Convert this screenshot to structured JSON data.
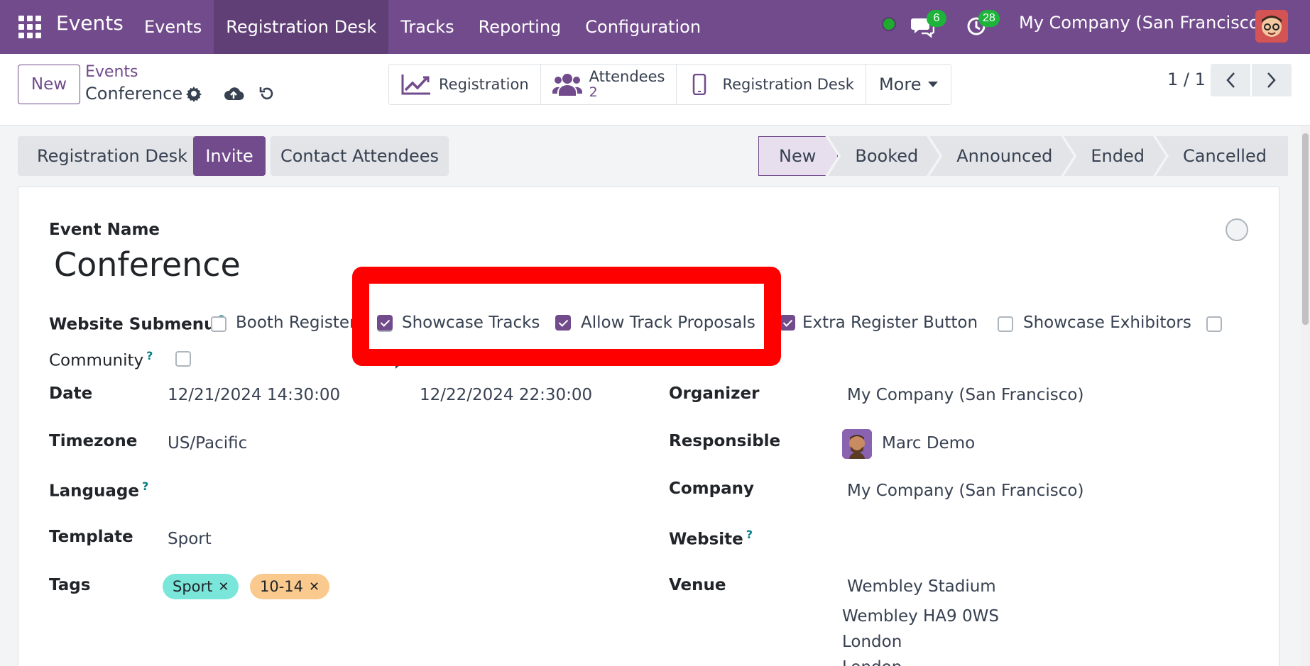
{
  "navbar": {
    "brand": "Events",
    "menu": [
      "Events",
      "Registration Desk",
      "Tracks",
      "Reporting",
      "Configuration"
    ],
    "chat_count": "6",
    "activity_count": "28",
    "company": "My Company (San Francisco)"
  },
  "control": {
    "new_label": "New",
    "breadcrumb_parent": "Events",
    "breadcrumb_current": "Conference",
    "smart_buttons": {
      "registration": "Registration",
      "attendees_label": "Attendees",
      "attendees_count": "2",
      "registration_desk": "Registration Desk",
      "more": "More"
    },
    "pager": "1 / 1"
  },
  "header": {
    "registration_desk": "Registration Desk",
    "invite": "Invite",
    "contact_attendees": "Contact Attendees",
    "stages": [
      "New",
      "Booked",
      "Announced",
      "Ended",
      "Cancelled"
    ],
    "active_stage": "New"
  },
  "form": {
    "event_name_label": "Event Name",
    "event_name": "Conference",
    "website_submenu_label": "Website Submenu",
    "help_mark": "?",
    "checkboxes": {
      "booth_register": {
        "label": "Booth Register",
        "checked": false
      },
      "showcase_tracks": {
        "label": "Showcase Tracks",
        "checked": true
      },
      "allow_track_proposals": {
        "label": "Allow Track Proposals",
        "checked": true
      },
      "extra_register_button": {
        "label": "Extra Register Button",
        "checked": true
      },
      "showcase_exhibitors": {
        "label": "Showcase Exhibitors",
        "checked": false
      },
      "community": {
        "label": "Community",
        "checked": false
      }
    },
    "date_label": "Date",
    "date_begin": "12/21/2024 14:30:00",
    "date_end": "12/22/2024 22:30:00",
    "timezone_label": "Timezone",
    "timezone": "US/Pacific",
    "language_label": "Language",
    "template_label": "Template",
    "template": "Sport",
    "tags_label": "Tags",
    "tags": [
      {
        "name": "Sport",
        "color": "#7ae6d9"
      },
      {
        "name": "10-14",
        "color": "#f9c98e"
      }
    ],
    "organizer_label": "Organizer",
    "organizer": "My Company (San Francisco)",
    "responsible_label": "Responsible",
    "responsible": "Marc Demo",
    "company_label": "Company",
    "company": "My Company (San Francisco)",
    "website_label": "Website",
    "venue_label": "Venue",
    "venue_lines": [
      "Wembley Stadium",
      "Wembley HA9 0WS",
      "London",
      "London"
    ]
  },
  "colors": {
    "brand": "#714b8b",
    "highlight": "#ff0000"
  }
}
